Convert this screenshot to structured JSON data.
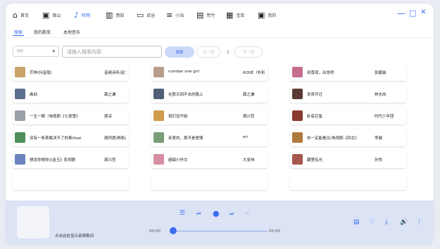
{
  "nav": {
    "items": [
      {
        "label": "首页",
        "icon": "home-icon",
        "glyph": "⌂"
      },
      {
        "label": "观山",
        "icon": "image-icon",
        "glyph": "▣"
      },
      {
        "label": "听雨",
        "icon": "music-note-icon",
        "glyph": "♪"
      },
      {
        "label": "感知",
        "icon": "book-icon",
        "glyph": "▥"
      },
      {
        "label": "武谷",
        "icon": "folder-icon",
        "glyph": "▭"
      },
      {
        "label": "小站",
        "icon": "list-icon",
        "glyph": "≡"
      },
      {
        "label": "梵竹",
        "icon": "calendar-icon",
        "glyph": "▤"
      },
      {
        "label": "宝库",
        "icon": "treasure-icon",
        "glyph": "▦"
      },
      {
        "label": "我的",
        "icon": "user-card-icon",
        "glyph": "▣"
      }
    ],
    "active_index": 2,
    "accent": "#3a6df0"
  },
  "window_controls": {
    "minimize": "—",
    "maximize": "□",
    "close": "✕"
  },
  "subtabs": {
    "items": [
      "搜索",
      "我的歌单",
      "本地音乐"
    ],
    "active_index": 0
  },
  "search": {
    "source_value": "QQ",
    "placeholder": "请输入搜索内容",
    "search_label": "搜索",
    "prev_label": "上一页",
    "page": "1",
    "next_label": "下一页"
  },
  "results": [
    {
      "song": "芒种(抖音版)",
      "artist": "音阙诗听/赵7",
      "color": "#c9a36a"
    },
    {
      "song": "number one girl",
      "artist": "ROSÉ（朴彩",
      "color": "#b89c8a"
    },
    {
      "song": "到尊现，出发吧",
      "artist": "张碧晨",
      "color": "#c46d8f"
    },
    {
      "song": "画劫",
      "artist": "薛之谦",
      "color": "#5b6f8e"
    },
    {
      "song": "在那天回不去的路上",
      "artist": "薛之谦",
      "color": "#4f6078"
    },
    {
      "song": "发育开过",
      "artist": "林志炫",
      "color": "#5c3b36"
    },
    {
      "song": "一生一瞬（电视剧《七夜雪》",
      "artist": "周深",
      "color": "#9aa0a8"
    },
    {
      "song": "我们没开始",
      "artist": "周兴哲",
      "color": "#d19a4d"
    },
    {
      "song": "卧底巨星",
      "artist": "时代少年团",
      "color": "#8a3a2f"
    },
    {
      "song": "没有一条茶解决不了的事(feat",
      "artist": "周柯君/杨和苏",
      "color": "#4e8f5a"
    },
    {
      "song": "亲爱的，那不是爱情",
      "artist": "en",
      "color": "#7a9f77"
    },
    {
      "song": "你一定能看见(电视剧《四北》",
      "artist": "李健",
      "color": "#b07a3c"
    },
    {
      "song": "想念你想你(《金玉》影视剧",
      "artist": "周兴哲",
      "color": "#6b84c0"
    },
    {
      "song": "超甜小作文",
      "artist": "大张伟",
      "color": "#d88ea1"
    },
    {
      "song": "翻里有光",
      "artist": "孙悦",
      "color": "#a7574b"
    }
  ],
  "player": {
    "lyrics_hint": "点击此处显示桌面歌词",
    "time_current": "00:00",
    "time_total": "00:00",
    "progress": 0
  }
}
